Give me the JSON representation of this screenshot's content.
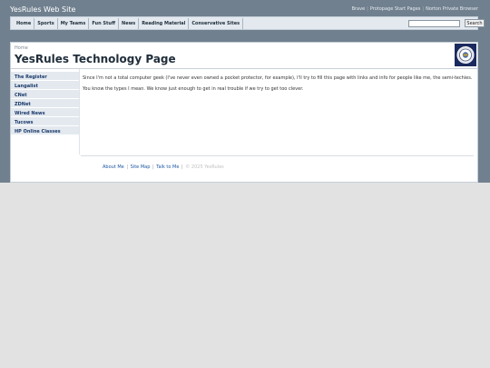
{
  "header": {
    "site_title": "YesRules Web Site",
    "top_links": [
      "Brave",
      "Protopage Start Pages",
      "Norton Private Browser"
    ]
  },
  "nav": {
    "items": [
      "Home",
      "Sports",
      "My Teams",
      "Fun Stuff",
      "News",
      "Reading Material",
      "Conservative Sites"
    ],
    "search_value": "",
    "search_button": "Search"
  },
  "page": {
    "breadcrumb": "Home",
    "title": "YesRules Technology Page",
    "logo_icon": "seal-logo-icon"
  },
  "sidebar": {
    "items": [
      "The Register",
      "Langalist",
      "CNet",
      "ZDNet",
      "Wired News",
      "Tucows",
      "HP Online Classes"
    ]
  },
  "main": {
    "paragraphs": [
      "Since I'm not a total computer geek (I've never even owned a pocket protector, for example), I'll try to fill this page with links and info for people like me, the semi-techies.",
      "You know the types I mean. We know just enough to get in real trouble if we try to get too clever."
    ]
  },
  "footer": {
    "links": [
      "About Me",
      "Site Map",
      "Talk to Me"
    ],
    "copyright": "© 2025 YesRules"
  },
  "colors": {
    "header_band": "#70808f",
    "nav_bg": "#e3e9ef",
    "link": "#1f57a3",
    "title": "#1f2d3a"
  }
}
